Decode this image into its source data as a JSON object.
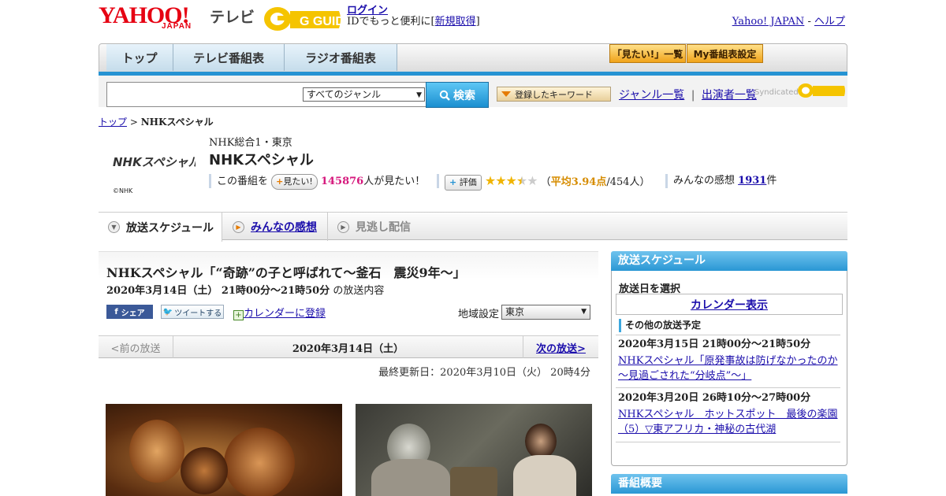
{
  "header": {
    "logo_yahoo": "YAHOO!",
    "logo_japan": "JAPAN",
    "logo_tv": "テレビ",
    "logo_gguide": "G GUIDE",
    "login": "ログイン",
    "login_sub_prefix": "IDでもっと便利に[",
    "login_signup": "新規取得",
    "login_sub_suffix": "]",
    "yahoo_japan": "Yahoo! JAPAN",
    "sep": " - ",
    "help": "ヘルプ"
  },
  "nav": {
    "tabs": [
      {
        "label": "トップ"
      },
      {
        "label": "テレビ番組表"
      },
      {
        "label": "ラジオ番組表"
      }
    ],
    "mitai_list": "「見たい!」一覧",
    "my_schedule": "My番組表設定"
  },
  "search": {
    "genre_selected": "すべてのジャンル",
    "button": "検索",
    "keywords": "登録したキーワード",
    "genre_list": "ジャンル一覧",
    "separator": "|",
    "performer_list": "出演者一覧",
    "syndicated": "Syndicated"
  },
  "breadcrumb": {
    "top": "トップ",
    "sep": " > ",
    "current": "NHKスペシャル"
  },
  "program": {
    "channel_logo": "NHKスペシャル",
    "copyright": "©NHK",
    "channel": "NHK総合1・東京",
    "title": "NHKスペシャル",
    "mitai_prefix": "この番組を",
    "mitai_button": "見たい!",
    "mitai_count": "145876",
    "mitai_suffix": "人が見たい！",
    "rating_button": "評価",
    "rating_open": "（",
    "rating_avg": "平均3.94点",
    "rating_count": "/454人）",
    "rating_value": 3.94,
    "impressions_prefix": "みんなの感想",
    "impressions_count": "1931",
    "impressions_suffix": "件"
  },
  "program_tabs": {
    "schedule": "放送スケジュール",
    "impressions": "みんなの感想",
    "catchup": "見逃し配信"
  },
  "episode": {
    "title": "NHKスペシャル「“奇跡”の子と呼ばれて～釜石　震災9年～」",
    "datetime": "2020年3月14日（土）  21時00分～21時50分",
    "datetime_suffix": "の放送内容",
    "share": "シェア",
    "tweet": "ツイートする",
    "calendar": "カレンダーに登録",
    "region_label": "地域設定",
    "region_selected": "東京",
    "prev": "<前の放送",
    "current_date": "2020年3月14日（土）",
    "next": "次の放送>",
    "updated": "最終更新日：2020年3月10日（火） 20時4分"
  },
  "sidebar": {
    "schedule_header": "放送スケジュール",
    "select_date": "放送日を選択",
    "calendar_show": "カレンダー表示",
    "other_broadcasts": "その他の放送予定",
    "items": [
      {
        "datetime": "2020年3月15日  21時00分～21時50分",
        "title": "NHKスペシャル「原発事故は防げなかったのか～見過ごされた“分岐点”～」"
      },
      {
        "datetime": "2020年3月20日  26時10分～27時00分",
        "title": "NHKスペシャル　ホットスポット　最後の楽園（5）▽東アフリカ・神秘の古代湖"
      }
    ],
    "overview_header": "番組概要"
  },
  "colors": {
    "brand_red": "#e60012",
    "accent_blue": "#2693d3",
    "link": "#1a0dab",
    "count_pink": "#d6197d",
    "rating_orange": "#d68c00"
  }
}
